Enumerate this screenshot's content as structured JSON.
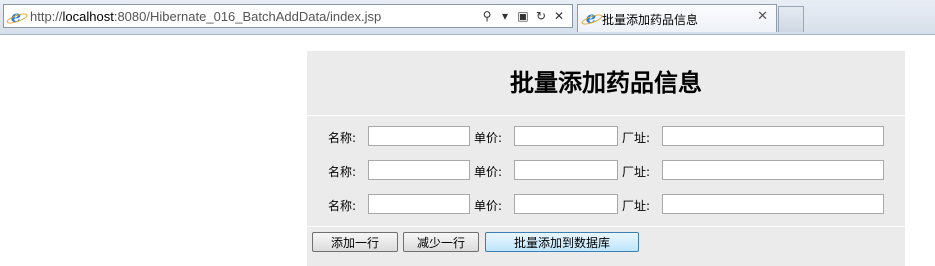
{
  "browser": {
    "url_prefix": "http://",
    "url_host": "localhost",
    "url_rest": ":8080/Hibernate_016_BatchAddData/index.jsp",
    "tab_title": "批量添加药品信息",
    "search_glyph": "⚲",
    "dropdown_glyph": "▾",
    "compat_glyph": "▣",
    "refresh_glyph": "↻",
    "stop_glyph": "✕",
    "tab_close_glyph": "✕",
    "icon_letter": "e"
  },
  "page": {
    "heading": "批量添加药品信息",
    "labels": {
      "name": "名称:",
      "price": "单价:",
      "factory": "厂址:"
    },
    "rows": [
      {
        "name": "",
        "price": "",
        "factory": ""
      },
      {
        "name": "",
        "price": "",
        "factory": ""
      },
      {
        "name": "",
        "price": "",
        "factory": ""
      }
    ],
    "buttons": {
      "add_row": "添加一行",
      "remove_row": "减少一行",
      "submit": "批量添加到数据库"
    }
  }
}
